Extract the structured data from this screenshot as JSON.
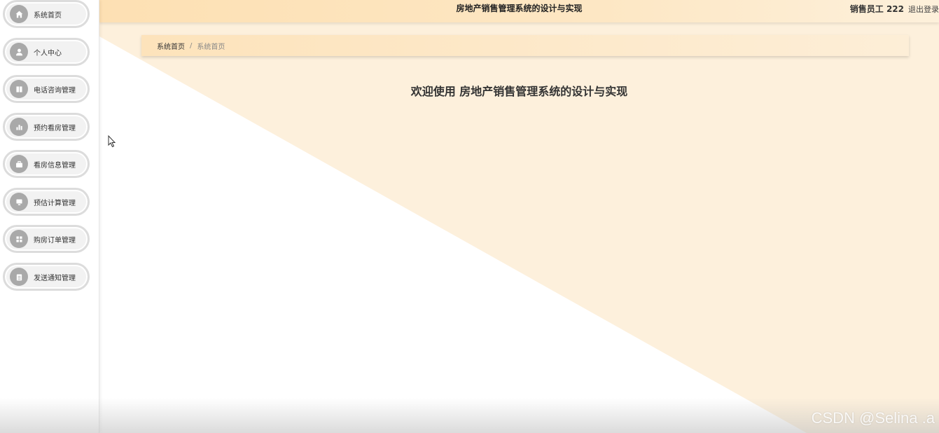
{
  "sidebar": {
    "items": [
      {
        "label": "系统首页",
        "icon": "home-icon"
      },
      {
        "label": "个人中心",
        "icon": "user-icon"
      },
      {
        "label": "电话咨询管理",
        "icon": "book-icon"
      },
      {
        "label": "预约看房管理",
        "icon": "bar-chart-icon"
      },
      {
        "label": "看房信息管理",
        "icon": "briefcase-icon"
      },
      {
        "label": "预估计算管理",
        "icon": "monitor-icon"
      },
      {
        "label": "购房订单管理",
        "icon": "grid-icon"
      },
      {
        "label": "发送通知管理",
        "icon": "clipboard-icon"
      }
    ]
  },
  "header": {
    "title": "房地产销售管理系统的设计与实现",
    "user": "销售员工 222",
    "logout": "退出登录"
  },
  "breadcrumb": {
    "home": "系统首页",
    "separator": "/",
    "current": "系统首页"
  },
  "main": {
    "welcome": "欢迎使用 房地产销售管理系统的设计与实现"
  },
  "watermark": "CSDN @Selina .a",
  "colors": {
    "accent": "#fde0b3",
    "background_triangle": "#fdf0dc",
    "icon_circle": "#a9a9a9"
  }
}
